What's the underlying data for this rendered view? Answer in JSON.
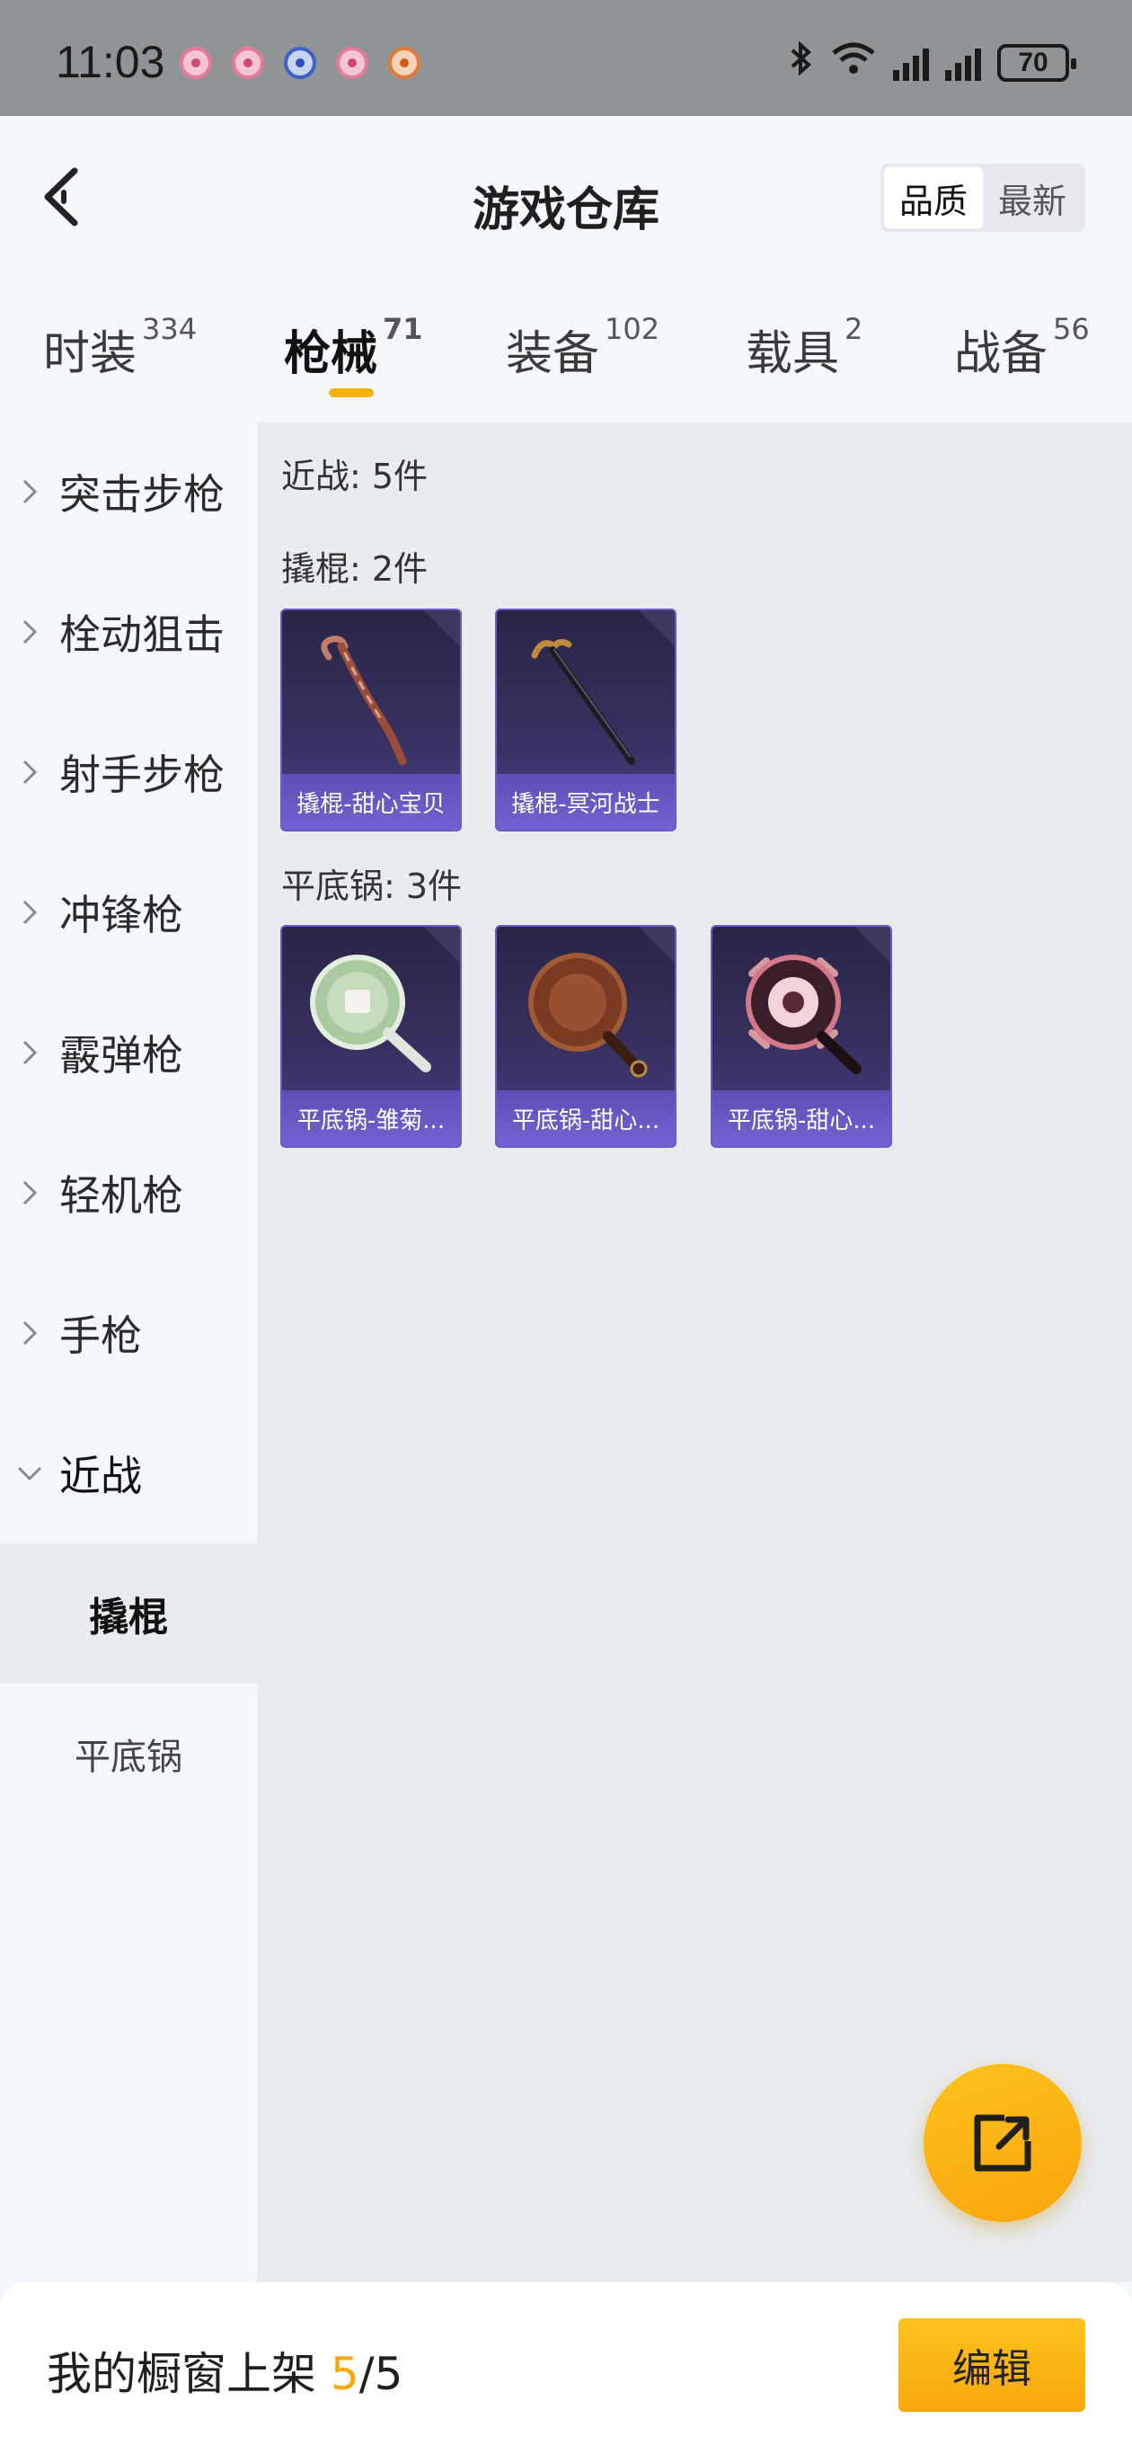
{
  "status_bar": {
    "time": "11:03",
    "battery": "70"
  },
  "header": {
    "title": "游戏仓库",
    "sort": {
      "quality": "品质",
      "newest": "最新",
      "active": "quality"
    }
  },
  "tabs": [
    {
      "label": "时装",
      "count": "334"
    },
    {
      "label": "枪械",
      "count": "71",
      "active": true
    },
    {
      "label": "装备",
      "count": "102"
    },
    {
      "label": "载具",
      "count": "2"
    },
    {
      "label": "战备",
      "count": "56"
    }
  ],
  "sidebar": {
    "categories": [
      "突击步枪",
      "栓动狙击",
      "射手步枪",
      "冲锋枪",
      "霰弹枪",
      "轻机枪",
      "手枪",
      "近战"
    ],
    "expanded": "近战",
    "subcategories": [
      "撬棍",
      "平底锅"
    ],
    "active_sub": "撬棍"
  },
  "content": {
    "section_title": "近战: 5件",
    "groups": [
      {
        "title": "撬棍: 2件",
        "items": [
          "撬棍-甜心宝贝",
          "撬棍-冥河战士"
        ]
      },
      {
        "title": "平底锅: 3件",
        "items": [
          "平底锅-雏菊...",
          "平底锅-甜心...",
          "平底锅-甜心..."
        ]
      }
    ]
  },
  "bottom_bar": {
    "shelf_label": "我的橱窗上架 ",
    "shelf_current": "5",
    "shelf_sep": "/",
    "shelf_total": "5",
    "edit_label": "编辑"
  },
  "colors": {
    "accent": "#f5b211",
    "card_bg": "#37305f",
    "card_label": "#6a5bc6"
  }
}
